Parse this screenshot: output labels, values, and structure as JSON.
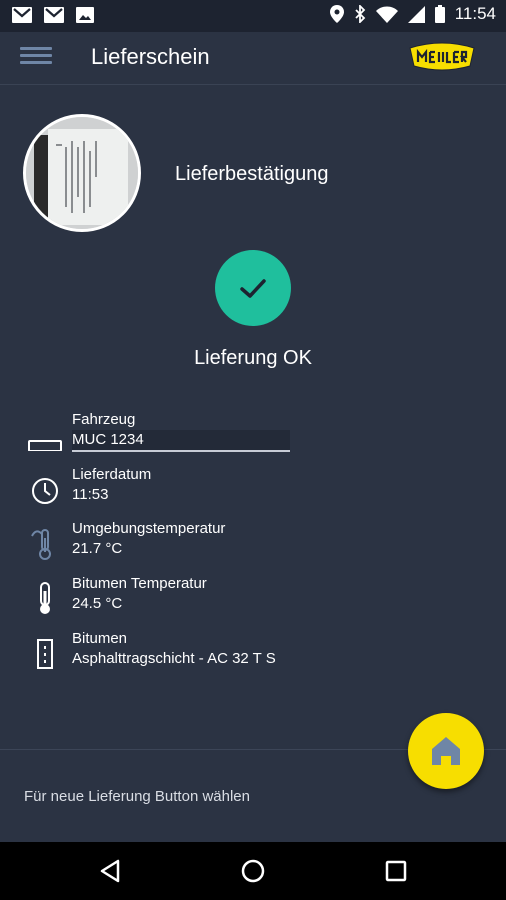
{
  "status_bar": {
    "time": "11:54",
    "left_icons": [
      "gmail-icon",
      "gmail-icon",
      "image-icon"
    ],
    "right_icons": [
      "location-icon",
      "bluetooth-icon",
      "wifi-icon",
      "signal-icon",
      "battery-icon"
    ]
  },
  "app_bar": {
    "title": "Lieferschein",
    "logo_text": "MEILLER"
  },
  "delivery": {
    "photo_title": "Lieferbestätigung",
    "status_label": "Lieferung OK",
    "status_color": "#1fbf9d"
  },
  "details": [
    {
      "icon": "truck-icon",
      "label": "Fahrzeug",
      "value": "MUC 1234"
    },
    {
      "icon": "clock-icon",
      "label": "Lieferdatum",
      "value": "11:53"
    },
    {
      "icon": "thermometer-ambient-icon",
      "label": "Umgebungstemperatur",
      "value": "21.7 °C"
    },
    {
      "icon": "thermometer-icon",
      "label": "Bitumen Temperatur",
      "value": "24.5 °C"
    },
    {
      "icon": "bitumen-icon",
      "label": "Bitumen",
      "value": "Asphalttragschicht - AC 32 T S"
    }
  ],
  "footer": {
    "hint": "Für neue Lieferung Button wählen",
    "fab_icon": "home-icon",
    "fab_color": "#f7de00"
  },
  "nav_bar": {
    "buttons": [
      "back-icon",
      "home-icon",
      "recents-icon"
    ]
  }
}
